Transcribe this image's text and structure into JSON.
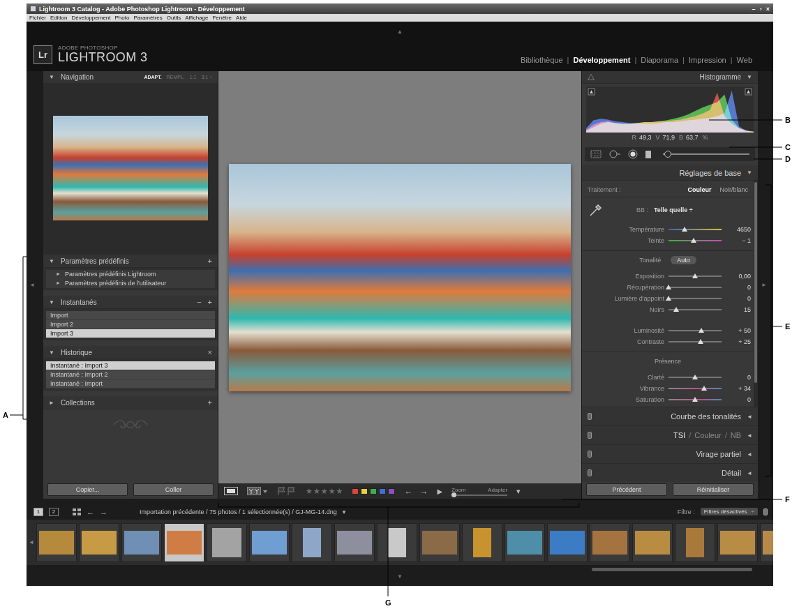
{
  "window": {
    "title": "Lightroom 3 Catalog - Adobe Photoshop Lightroom - Développement",
    "controls": [
      "–",
      "▫",
      "×"
    ]
  },
  "menu": [
    "Fichier",
    "Edition",
    "Développement",
    "Photo",
    "Paramètres",
    "Outils",
    "Affichage",
    "Fenêtre",
    "Aide"
  ],
  "identity": {
    "logo": "Lr",
    "brand_top": "ADOBE PHOTOSHOP",
    "brand": "LIGHTROOM 3"
  },
  "modules": [
    {
      "label": "Bibliothèque",
      "selected": false
    },
    {
      "label": "Développement",
      "selected": true
    },
    {
      "label": "Diaporama",
      "selected": false
    },
    {
      "label": "Impression",
      "selected": false
    },
    {
      "label": "Web",
      "selected": false
    }
  ],
  "module_separator": "|",
  "edge_arrows": {
    "top": "▲",
    "left": "◄",
    "right": "►",
    "bottom": "▼",
    "film_left": "◄"
  },
  "navigator": {
    "title": "Navigation",
    "toggle": "▼",
    "zoom": [
      {
        "label": "ADAPT.",
        "selected": true
      },
      {
        "label": "REMPL.",
        "selected": false
      },
      {
        "label": "1:1",
        "selected": false
      },
      {
        "label": "3:1 ÷",
        "selected": false
      }
    ]
  },
  "left_sections": [
    {
      "title": "Paramètres prédéfinis",
      "toggle": "▼",
      "expanded": true,
      "actions": [
        "+"
      ],
      "items": [
        {
          "label": "Paramètres prédéfinis Lightroom",
          "toggle": "►",
          "selected": false
        },
        {
          "label": "Paramètres prédéfinis de l'utilisateur",
          "toggle": "►",
          "selected": false
        }
      ]
    },
    {
      "title": "Instantanés",
      "toggle": "▼",
      "expanded": true,
      "actions": [
        "−",
        "+"
      ],
      "items": [
        {
          "label": "Import",
          "selected": false
        },
        {
          "label": "Import 2",
          "selected": false
        },
        {
          "label": "Import 3",
          "selected": true
        }
      ]
    },
    {
      "title": "Historique",
      "toggle": "▼",
      "expanded": true,
      "actions": [
        "×"
      ],
      "items": [
        {
          "label": "Instantané : Import 3",
          "selected": true
        },
        {
          "label": "Instantané : Import 2",
          "selected": false
        },
        {
          "label": "Instantané : Import",
          "selected": false
        }
      ]
    },
    {
      "title": "Collections",
      "toggle": "►",
      "expanded": false,
      "actions": [
        "+"
      ],
      "items": []
    }
  ],
  "left_buttons": [
    "Copier...",
    "Coller"
  ],
  "toolbar": {
    "stars_text": "★★★★★",
    "stars": 0,
    "labels": [
      {
        "color": "#d9453f"
      },
      {
        "color": "#e8d23a"
      },
      {
        "color": "#3fae49"
      },
      {
        "color": "#3d6fd6"
      },
      {
        "color": "#8c4fc6"
      }
    ],
    "nav": [
      "←",
      "→"
    ],
    "play": "▶",
    "zoom_label": "Zoom",
    "zoom_value": "Adapter",
    "zoom_level": 0,
    "menu": "▾"
  },
  "histogram": {
    "title": "Histogramme",
    "toggle": "▼",
    "series": [
      {
        "color": "#e0302a",
        "values": [
          6,
          18,
          24,
          26,
          22,
          20,
          20,
          22,
          24,
          24,
          26,
          26,
          28,
          30,
          34,
          38,
          44,
          52,
          92,
          38,
          20,
          10,
          5,
          2
        ]
      },
      {
        "color": "#3ec03a",
        "values": [
          4,
          12,
          20,
          24,
          22,
          20,
          20,
          22,
          24,
          24,
          26,
          28,
          32,
          36,
          42,
          50,
          58,
          64,
          70,
          88,
          30,
          10,
          4,
          2
        ]
      },
      {
        "color": "#3a6ae0",
        "values": [
          10,
          28,
          32,
          30,
          26,
          24,
          22,
          22,
          20,
          20,
          22,
          24,
          24,
          26,
          28,
          30,
          32,
          34,
          38,
          44,
          97,
          14,
          4,
          2
        ]
      }
    ],
    "readout": [
      {
        "label": "R",
        "value": "49,3"
      },
      {
        "label": "V",
        "value": "71,9"
      },
      {
        "label": "B",
        "value": "63,7"
      }
    ],
    "unit": "%"
  },
  "tool_slider": {
    "level": 0.06
  },
  "basic": {
    "title": "Réglages de base",
    "toggle": "▼",
    "treatment": {
      "label": "Traitement :",
      "options": [
        {
          "label": "Couleur",
          "selected": true
        },
        {
          "label": "Noir/blanc",
          "selected": false
        }
      ]
    },
    "wb": {
      "label": "BB :",
      "value": "Telle quelle ÷"
    },
    "wb_sliders": [
      {
        "label": "Température",
        "value": "4650",
        "level": 0.3,
        "kind": "temp"
      },
      {
        "label": "Teinte",
        "value": "− 1",
        "level": 0.48,
        "kind": "tint"
      }
    ],
    "tone": {
      "title": "Tonalité",
      "button": "Auto",
      "groups": [
        [
          {
            "label": "Exposition",
            "value": "0,00",
            "level": 0.5,
            "kind": "plain"
          },
          {
            "label": "Récupération",
            "value": "0",
            "level": 0,
            "kind": "plain"
          },
          {
            "label": "Lumière d'appoint",
            "value": "0",
            "level": 0,
            "kind": "plain"
          },
          {
            "label": "Noirs",
            "value": "15",
            "level": 0.15,
            "kind": "plain"
          }
        ],
        [
          {
            "label": "Luminosité",
            "value": "+ 50",
            "level": 0.62,
            "kind": "plain"
          },
          {
            "label": "Contraste",
            "value": "+ 25",
            "level": 0.6,
            "kind": "plain"
          }
        ]
      ]
    },
    "presence": {
      "title": "Présence",
      "sliders": [
        {
          "label": "Clarté",
          "value": "0",
          "level": 0.5,
          "kind": "plain"
        },
        {
          "label": "Vibrance",
          "value": "+ 34",
          "level": 0.67,
          "kind": "sat"
        },
        {
          "label": "Saturation",
          "value": "0",
          "level": 0.5,
          "kind": "sat"
        }
      ]
    }
  },
  "collapsed_panels": [
    {
      "title": "Courbe des tonalités",
      "toggle": "◄"
    },
    {
      "tabs": [
        {
          "label": "TSI",
          "selected": true
        },
        {
          "label": "Couleur",
          "selected": false
        },
        {
          "label": "NB",
          "selected": false
        }
      ],
      "separator": "/",
      "toggle": "◄"
    },
    {
      "title": "Virage partiel",
      "toggle": "◄"
    },
    {
      "title": "Détail",
      "toggle": "◄"
    }
  ],
  "right_buttons": [
    "Précédent",
    "Réinitialiser"
  ],
  "filmstrip": {
    "screens": [
      {
        "label": "1",
        "selected": true
      },
      {
        "label": "2",
        "selected": false
      }
    ],
    "nav": [
      "←",
      "→"
    ],
    "source": "Importation précédente / 75 photos / 1 sélectionnée(s) / GJ-MG-14.dng",
    "source_menu": "▾",
    "filter_label": "Filtre :",
    "filter_value": "Filtres désactivés",
    "filter_menu": "÷",
    "thumbnails": [
      {
        "kind": "landscape",
        "color": "#b58a3c",
        "selected": false
      },
      {
        "kind": "landscape",
        "color": "#c79b45",
        "selected": false
      },
      {
        "kind": "landscape",
        "color": "#6f8fb4",
        "selected": false
      },
      {
        "kind": "landscape",
        "color": "#cf7d45",
        "selected": true
      },
      {
        "kind": "square",
        "color": "#a3a3a3",
        "selected": false
      },
      {
        "kind": "landscape",
        "color": "#6f9fd2",
        "selected": false
      },
      {
        "kind": "portrait",
        "color": "#8ea7c9",
        "selected": false
      },
      {
        "kind": "landscape",
        "color": "#8d8f9e",
        "selected": false
      },
      {
        "kind": "portrait",
        "color": "#c9c9c9",
        "selected": false
      },
      {
        "kind": "landscape",
        "color": "#8b6a48",
        "selected": false
      },
      {
        "kind": "portrait",
        "color": "#c8922e",
        "selected": false
      },
      {
        "kind": "landscape",
        "color": "#4f8ea8",
        "selected": false
      },
      {
        "kind": "landscape",
        "color": "#3b7cc4",
        "selected": false
      },
      {
        "kind": "landscape",
        "color": "#a5733f",
        "selected": false
      },
      {
        "kind": "landscape",
        "color": "#b88d42",
        "selected": false
      },
      {
        "kind": "portrait",
        "color": "#a8793a",
        "selected": false
      },
      {
        "kind": "landscape",
        "color": "#b98c45",
        "selected": false
      },
      {
        "kind": "landscape",
        "color": "#b78a4c",
        "selected": false
      }
    ]
  },
  "callouts": [
    {
      "label": "A"
    },
    {
      "label": "B"
    },
    {
      "label": "C"
    },
    {
      "label": "D"
    },
    {
      "label": "E"
    },
    {
      "label": "F"
    },
    {
      "label": "G"
    }
  ]
}
